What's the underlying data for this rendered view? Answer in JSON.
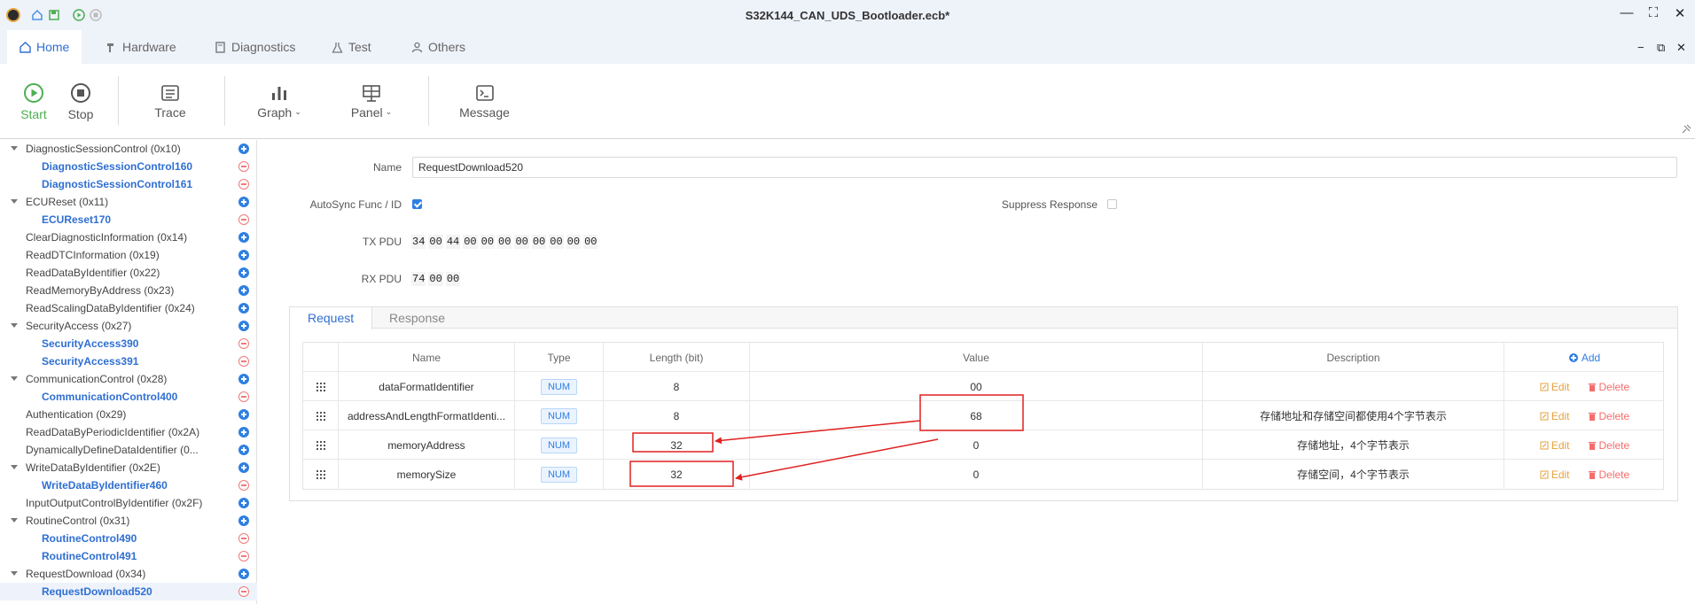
{
  "window": {
    "title": "S32K144_CAN_UDS_Bootloader.ecb*",
    "controls": [
      "—",
      "⛶",
      "✕"
    ],
    "doc_controls": [
      "−",
      "⧉",
      "✕"
    ]
  },
  "tabs": [
    {
      "label": "Home",
      "icon": "home-icon",
      "active": true
    },
    {
      "label": "Hardware",
      "icon": "hammer-icon",
      "active": false
    },
    {
      "label": "Diagnostics",
      "icon": "book-icon",
      "active": false
    },
    {
      "label": "Test",
      "icon": "flask-icon",
      "active": false
    },
    {
      "label": "Others",
      "icon": "user-icon",
      "active": false
    }
  ],
  "toolbar": {
    "start": "Start",
    "stop": "Stop",
    "trace": "Trace",
    "graph": "Graph",
    "panel": "Panel",
    "message": "Message"
  },
  "tree": [
    {
      "label": "DiagnosticSessionControl (0x10)",
      "level": 0,
      "expanded": true,
      "action": "add"
    },
    {
      "label": "DiagnosticSessionControl160",
      "level": 1,
      "action": "remove"
    },
    {
      "label": "DiagnosticSessionControl161",
      "level": 1,
      "action": "remove"
    },
    {
      "label": "ECUReset (0x11)",
      "level": 0,
      "expanded": true,
      "action": "add"
    },
    {
      "label": "ECUReset170",
      "level": 1,
      "action": "remove"
    },
    {
      "label": "ClearDiagnosticInformation (0x14)",
      "level": 0,
      "action": "add"
    },
    {
      "label": "ReadDTCInformation (0x19)",
      "level": 0,
      "action": "add"
    },
    {
      "label": "ReadDataByIdentifier (0x22)",
      "level": 0,
      "action": "add"
    },
    {
      "label": "ReadMemoryByAddress (0x23)",
      "level": 0,
      "action": "add"
    },
    {
      "label": "ReadScalingDataByIdentifier (0x24)",
      "level": 0,
      "action": "add"
    },
    {
      "label": "SecurityAccess (0x27)",
      "level": 0,
      "expanded": true,
      "action": "add"
    },
    {
      "label": "SecurityAccess390",
      "level": 1,
      "action": "remove"
    },
    {
      "label": "SecurityAccess391",
      "level": 1,
      "action": "remove"
    },
    {
      "label": "CommunicationControl (0x28)",
      "level": 0,
      "expanded": true,
      "action": "add"
    },
    {
      "label": "CommunicationControl400",
      "level": 1,
      "action": "remove"
    },
    {
      "label": "Authentication (0x29)",
      "level": 0,
      "action": "add"
    },
    {
      "label": "ReadDataByPeriodicIdentifier (0x2A)",
      "level": 0,
      "action": "add"
    },
    {
      "label": "DynamicallyDefineDataIdentifier (0...",
      "level": 0,
      "action": "add"
    },
    {
      "label": "WriteDataByIdentifier (0x2E)",
      "level": 0,
      "expanded": true,
      "action": "add"
    },
    {
      "label": "WriteDataByIdentifier460",
      "level": 1,
      "action": "remove"
    },
    {
      "label": "InputOutputControlByIdentifier (0x2F)",
      "level": 0,
      "action": "add"
    },
    {
      "label": "RoutineControl (0x31)",
      "level": 0,
      "expanded": true,
      "action": "add"
    },
    {
      "label": "RoutineControl490",
      "level": 1,
      "action": "remove"
    },
    {
      "label": "RoutineControl491",
      "level": 1,
      "action": "remove"
    },
    {
      "label": "RequestDownload (0x34)",
      "level": 0,
      "expanded": true,
      "action": "add"
    },
    {
      "label": "RequestDownload520",
      "level": 1,
      "action": "remove",
      "selected": true
    }
  ],
  "form": {
    "name_label": "Name",
    "name_value": "RequestDownload520",
    "autosync_label": "AutoSync Func / ID",
    "autosync_checked": true,
    "suppress_label": "Suppress Response",
    "suppress_checked": false,
    "tx_label": "TX PDU",
    "tx_bytes": [
      "34",
      "00",
      "44",
      "00",
      "00",
      "00",
      "00",
      "00",
      "00",
      "00",
      "00"
    ],
    "rx_label": "RX PDU",
    "rx_bytes": [
      "74",
      "00",
      "00"
    ]
  },
  "panel_tabs": [
    "Request",
    "Response"
  ],
  "table": {
    "headers": [
      "Name",
      "Type",
      "Length (bit)",
      "Value",
      "Description"
    ],
    "add_label": "Add",
    "edit_label": "Edit",
    "delete_label": "Delete",
    "rows": [
      {
        "name": "dataFormatIdentifier",
        "type": "NUM",
        "length": "8",
        "value": "00",
        "description": ""
      },
      {
        "name": "addressAndLengthFormatIdenti...",
        "type": "NUM",
        "length": "8",
        "value": "68",
        "description": "存储地址和存储空间都使用4个字节表示"
      },
      {
        "name": "memoryAddress",
        "type": "NUM",
        "length": "32",
        "value": "0",
        "description": "存储地址，4个字节表示"
      },
      {
        "name": "memorySize",
        "type": "NUM",
        "length": "32",
        "value": "0",
        "description": "存储空间，4个字节表示"
      }
    ]
  },
  "colors": {
    "accent": "#2f6fd2",
    "add": "#2f7fe2",
    "remove": "#f07a7a",
    "edit": "#e6a23c",
    "delete": "#f56c6c",
    "annotation": "#e02020",
    "start": "#4caf50"
  }
}
